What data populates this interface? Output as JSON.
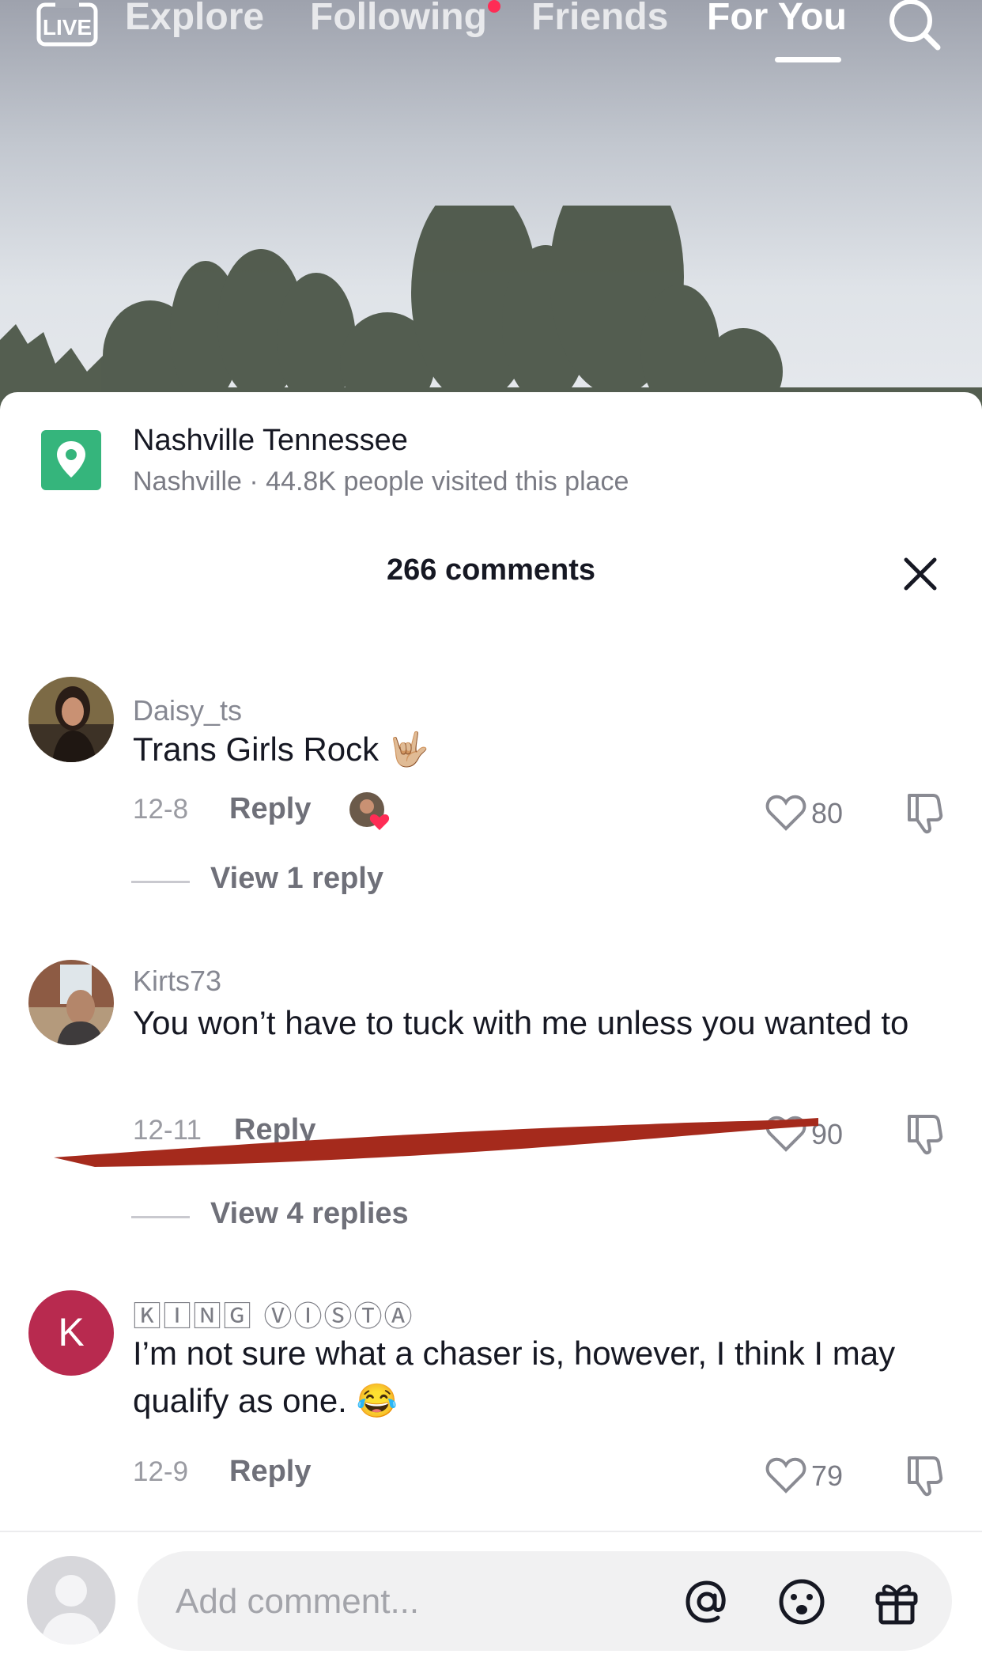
{
  "nav": {
    "tabs": [
      {
        "label": "Explore"
      },
      {
        "label": "Following"
      },
      {
        "label": "Friends"
      },
      {
        "label": "For You"
      }
    ],
    "live_label": "LIVE",
    "active_tab": "For You",
    "following_has_notification": true
  },
  "location": {
    "title": "Nashville Tennessee",
    "subtitle": "Nashville · 44.8K people visited this place",
    "icon": "map-pin-icon",
    "color": "#35b57c"
  },
  "comments_header": {
    "count_label": "266 comments"
  },
  "comments": [
    {
      "username": "Daisy_ts",
      "text": "Trans Girls Rock 🤟🏼",
      "date": "12-8",
      "reply_label": "Reply",
      "likes": "80",
      "liked_by_creator": true,
      "view_replies": "View 1 reply"
    },
    {
      "username": "Kirts73",
      "text": "You won’t have to tuck with me unless you wanted to",
      "date": "12-11",
      "reply_label": "Reply",
      "likes": "90",
      "view_replies": "View 4 replies"
    },
    {
      "username": "🄺🄸🄽🄶 ⓋⒾⓈⓉⒶ",
      "avatar_letter": "K",
      "text": "I’m not sure what a chaser is, however, I think I may qualify as one. 😂",
      "date": "12-9",
      "reply_label": "Reply",
      "likes": "79"
    }
  ],
  "composer": {
    "placeholder": "Add comment...",
    "icons": [
      "at-mention-icon",
      "emoji-icon",
      "gift-icon"
    ]
  },
  "colors": {
    "accent_red": "#fe2c55",
    "scribble": "#a52a1c"
  }
}
